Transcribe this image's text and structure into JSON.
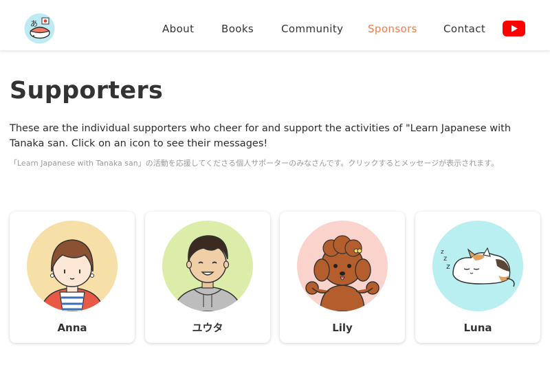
{
  "header": {
    "logo_icon": "sushi-logo-icon",
    "nav": [
      {
        "label": "About"
      },
      {
        "label": "Books"
      },
      {
        "label": "Community"
      },
      {
        "label": "Sponsors"
      },
      {
        "label": "Contact"
      }
    ],
    "active_nav": "Sponsors",
    "youtube_icon": "youtube-icon"
  },
  "main": {
    "title": "Supporters",
    "intro_en": "These are the individual supporters who cheer for and support the activities of \"Learn Japanese with Tanaka san. Click on an icon to see their messages!",
    "intro_ja": "「Learn Japanese with Tanaka san」の活動を応援してくださる個人サポーターのみなさんです。クリックするとメッセージが表示されます。"
  },
  "supporters": [
    {
      "name": "Anna",
      "icon": "girl-avatar-icon"
    },
    {
      "name": "ユウタ",
      "icon": "boy-avatar-icon"
    },
    {
      "name": "Lily",
      "icon": "poodle-avatar-icon"
    },
    {
      "name": "Luna",
      "icon": "sleeping-cat-avatar-icon"
    }
  ],
  "colors": {
    "accent": "#f07b4d",
    "text": "#333333",
    "subtext": "#9a9a9a",
    "youtube": "#ff0000"
  }
}
